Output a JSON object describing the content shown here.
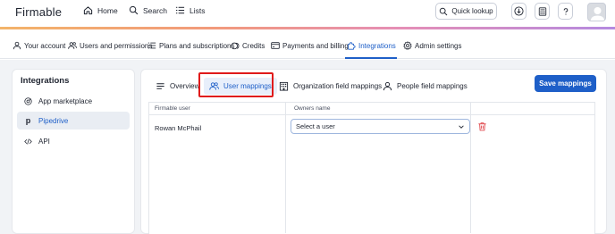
{
  "header": {
    "logo": "Firmable",
    "nav": [
      {
        "label": "Home",
        "icon": "home-icon"
      },
      {
        "label": "Search",
        "icon": "search-icon"
      },
      {
        "label": "Lists",
        "icon": "list-icon"
      }
    ],
    "quick_lookup": "Quick lookup",
    "icon_buttons": [
      "download-icon",
      "calculator-icon",
      "help-icon"
    ]
  },
  "settings_tabs": [
    {
      "label": "Your account",
      "icon": "user-icon"
    },
    {
      "label": "Users and permissions",
      "icon": "users-icon"
    },
    {
      "label": "Plans and subscriptions",
      "icon": "list-icon"
    },
    {
      "label": "Credits",
      "icon": "credits-icon"
    },
    {
      "label": "Payments and billing",
      "icon": "card-icon"
    },
    {
      "label": "Integrations",
      "icon": "puzzle-icon",
      "active": true
    },
    {
      "label": "Admin settings",
      "icon": "gear-icon"
    }
  ],
  "sidebar": {
    "title": "Integrations",
    "items": [
      {
        "label": "App marketplace",
        "icon": "marketplace-icon"
      },
      {
        "label": "Pipedrive",
        "icon": "pipedrive-icon",
        "active": true
      },
      {
        "label": "API",
        "icon": "code-icon"
      }
    ]
  },
  "main": {
    "tabs": [
      {
        "label": "Overview",
        "icon": "menu-icon"
      },
      {
        "label": "User mappings",
        "icon": "users-icon",
        "active": true
      },
      {
        "label": "Organization field mappings",
        "icon": "building-icon"
      },
      {
        "label": "People field mappings",
        "icon": "user-icon"
      }
    ],
    "save_label": "Save mappings",
    "table": {
      "columns": [
        "Firmable user",
        "Owners name"
      ],
      "rows": [
        {
          "user": "Rowan McPhail",
          "owner_placeholder": "Select a user"
        }
      ]
    }
  },
  "colors": {
    "accent": "#1e5fc8",
    "highlight": "#e01b1b",
    "delete": "#e0474c"
  }
}
